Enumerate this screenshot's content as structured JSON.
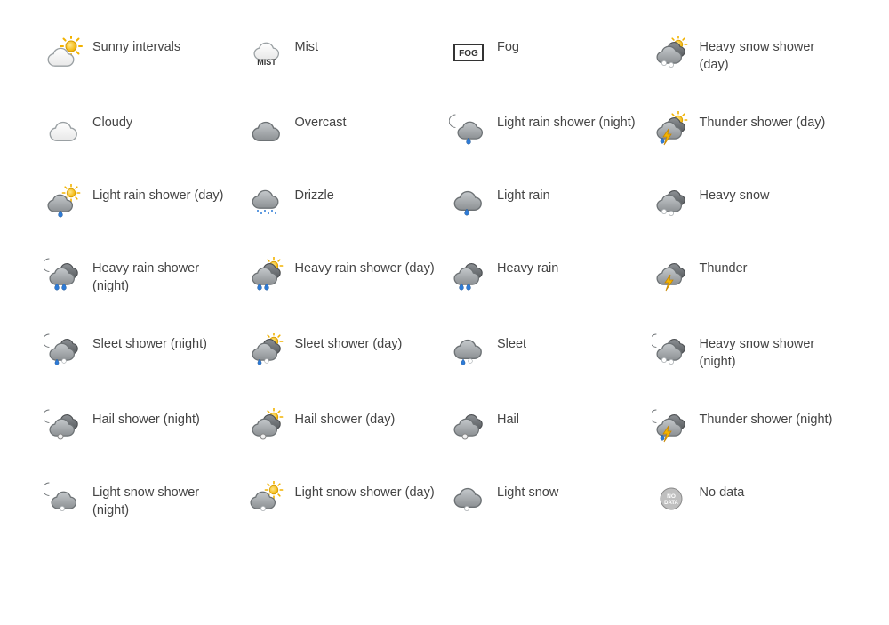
{
  "columns": 4,
  "items": [
    {
      "icon": "sunny-intervals-icon",
      "label": "Sunny intervals"
    },
    {
      "icon": "mist-icon",
      "label": "Mist"
    },
    {
      "icon": "fog-icon",
      "label": "Fog"
    },
    {
      "icon": "heavy-snow-shower-day-icon",
      "label": "Heavy snow shower (day)"
    },
    {
      "icon": "cloudy-icon",
      "label": "Cloudy"
    },
    {
      "icon": "overcast-icon",
      "label": "Overcast"
    },
    {
      "icon": "light-rain-shower-night-icon",
      "label": "Light rain shower (night)"
    },
    {
      "icon": "thunder-shower-day-icon",
      "label": "Thunder shower (day)"
    },
    {
      "icon": "light-rain-shower-day-icon",
      "label": "Light rain shower (day)"
    },
    {
      "icon": "drizzle-icon",
      "label": "Drizzle"
    },
    {
      "icon": "light-rain-icon",
      "label": "Light rain"
    },
    {
      "icon": "heavy-snow-icon",
      "label": "Heavy snow"
    },
    {
      "icon": "heavy-rain-shower-night-icon",
      "label": "Heavy rain shower (night)"
    },
    {
      "icon": "heavy-rain-shower-day-icon",
      "label": "Heavy rain shower (day)"
    },
    {
      "icon": "heavy-rain-icon",
      "label": "Heavy rain"
    },
    {
      "icon": "thunder-icon",
      "label": "Thunder"
    },
    {
      "icon": "sleet-shower-night-icon",
      "label": "Sleet shower (night)"
    },
    {
      "icon": "sleet-shower-day-icon",
      "label": "Sleet shower (day)"
    },
    {
      "icon": "sleet-icon",
      "label": "Sleet"
    },
    {
      "icon": "heavy-snow-shower-night-icon",
      "label": "Heavy snow shower (night)"
    },
    {
      "icon": "hail-shower-night-icon",
      "label": "Hail shower (night)"
    },
    {
      "icon": "hail-shower-day-icon",
      "label": "Hail shower (day)"
    },
    {
      "icon": "hail-icon",
      "label": "Hail"
    },
    {
      "icon": "thunder-shower-night-icon",
      "label": "Thunder shower (night)"
    },
    {
      "icon": "light-snow-shower-night-icon",
      "label": "Light snow shower (night)"
    },
    {
      "icon": "light-snow-shower-day-icon",
      "label": "Light snow shower (day)"
    },
    {
      "icon": "light-snow-icon",
      "label": "Light snow"
    },
    {
      "icon": "no-data-icon",
      "label": "No data"
    }
  ]
}
